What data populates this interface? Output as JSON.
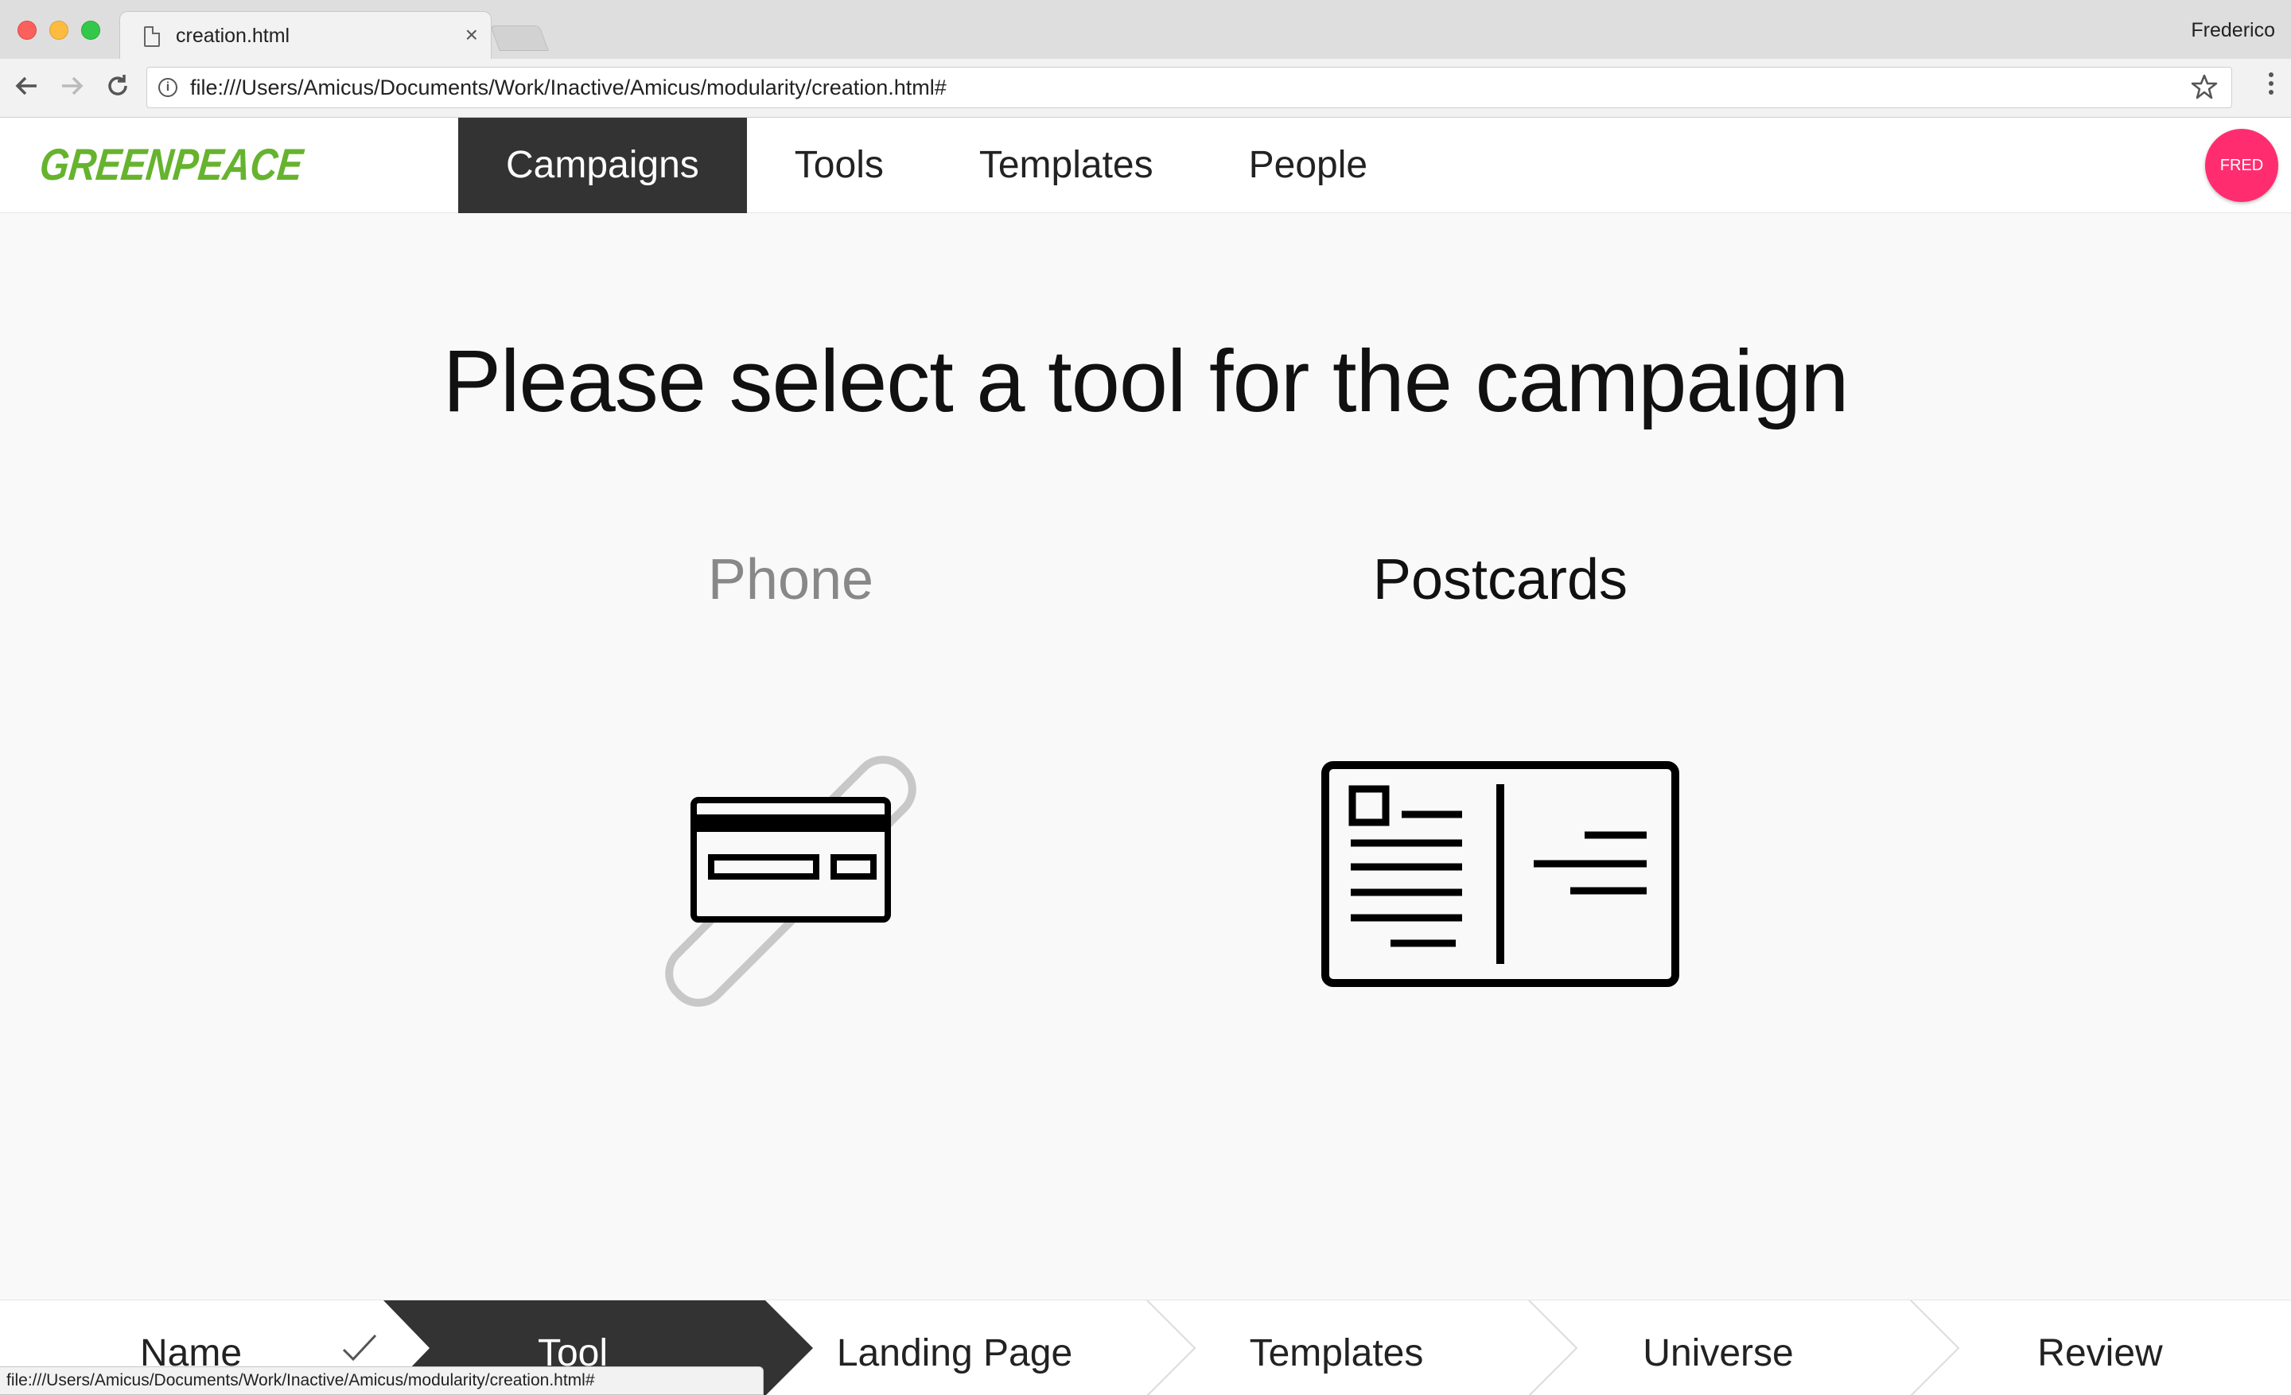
{
  "browser": {
    "tab_title": "creation.html",
    "tab_close": "×",
    "profile_name": "Frederico",
    "url": "file:///Users/Amicus/Documents/Work/Inactive/Amicus/modularity/creation.html#",
    "status_url": "file:///Users/Amicus/Documents/Work/Inactive/Amicus/modularity/creation.html#",
    "icons": [
      "back-icon",
      "forward-icon",
      "reload-icon",
      "info-icon",
      "star-icon",
      "menu-icon",
      "page-icon"
    ]
  },
  "header": {
    "logo_text": "GREENPEACE",
    "logo_color": "#66b32e",
    "nav": [
      {
        "label": "Campaigns",
        "active": true
      },
      {
        "label": "Tools",
        "active": false
      },
      {
        "label": "Templates",
        "active": false
      },
      {
        "label": "People",
        "active": false
      }
    ],
    "avatar_label": "FRED",
    "avatar_color": "#ff2d6f"
  },
  "main": {
    "title": "Please select a tool for the campaign",
    "tools": [
      {
        "label": "Phone",
        "icon": "phone-card-icon",
        "selected": false
      },
      {
        "label": "Postcards",
        "icon": "postcard-icon",
        "selected": true
      }
    ]
  },
  "stepper": {
    "steps": [
      {
        "label": "Name",
        "state": "done"
      },
      {
        "label": "Tool",
        "state": "active"
      },
      {
        "label": "Landing Page",
        "state": "pending"
      },
      {
        "label": "Templates",
        "state": "pending"
      },
      {
        "label": "Universe",
        "state": "pending"
      },
      {
        "label": "Review",
        "state": "pending"
      }
    ],
    "active_color": "#333333"
  }
}
